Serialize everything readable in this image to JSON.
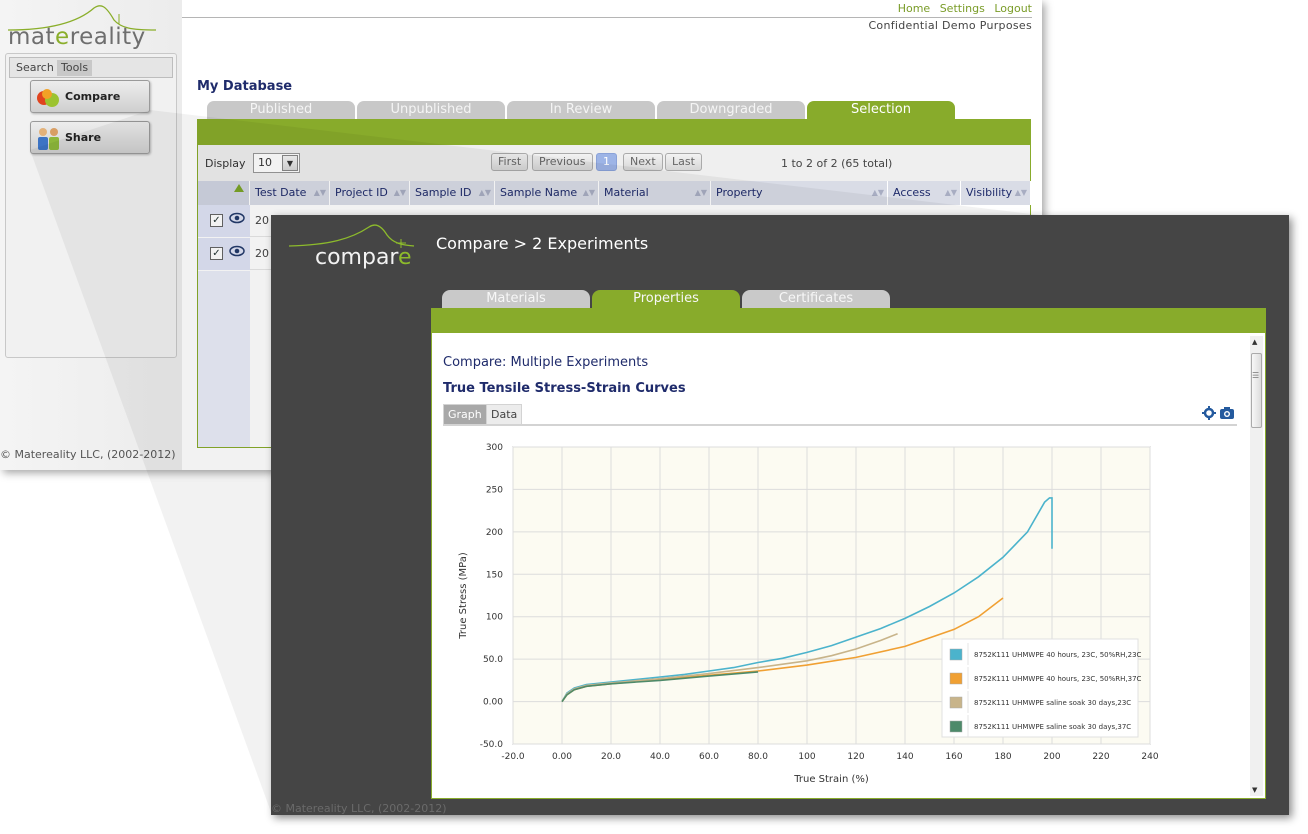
{
  "back": {
    "brand": {
      "prefix": "mat",
      "highlight": "e",
      "suffix": "reality"
    },
    "sidebar_tabs": [
      "Search",
      "Tools"
    ],
    "tools": [
      {
        "label": "Compare",
        "icon": "fruits-icon"
      },
      {
        "label": "Share",
        "icon": "people-icon"
      }
    ],
    "footer": "© Matereality LLC, (2002-2012)",
    "top_links": [
      "Home",
      "Settings",
      "Logout"
    ],
    "confidential": "Confidential Demo Purposes",
    "title": "My Database",
    "status_tabs": [
      "Published",
      "Unpublished",
      "In Review",
      "Downgraded",
      "Selection"
    ],
    "active_status_tab": "Selection",
    "display_label": "Display",
    "display_value": "10",
    "pager": {
      "first": "First",
      "previous": "Previous",
      "current": "1",
      "next": "Next",
      "last": "Last"
    },
    "range_text": "1 to 2 of 2 (65 total)",
    "columns": [
      "Test Date",
      "Project ID",
      "Sample ID",
      "Sample Name",
      "Material",
      "Property",
      "Access",
      "Visibility"
    ],
    "rows": [
      {
        "date_fragment": "20"
      },
      {
        "date_fragment": "20"
      }
    ]
  },
  "front": {
    "logo": {
      "prefix": "compar",
      "highlight": "e"
    },
    "heading": "Compare > 2 Experiments",
    "tabs": [
      "Materials",
      "Properties",
      "Certificates"
    ],
    "active_tab": "Properties",
    "subtitle": "Compare: Multiple Experiments",
    "chart_heading": "True Tensile Stress-Strain Curves",
    "view_tabs": [
      "Graph",
      "Data"
    ],
    "active_view": "Graph",
    "footer": "© Matereality LLC, (2002-2012)"
  },
  "chart_data": {
    "type": "line",
    "title": "",
    "xlabel": "True Strain (%)",
    "ylabel": "True Stress (MPa)",
    "xlim": [
      -20,
      240
    ],
    "ylim": [
      -50,
      300
    ],
    "x_ticks": [
      "-20.0",
      "0.00",
      "20.0",
      "40.0",
      "60.0",
      "80.0",
      "100",
      "120",
      "140",
      "160",
      "180",
      "200",
      "220",
      "240"
    ],
    "y_ticks": [
      "-50.0",
      "0.00",
      "50.0",
      "100",
      "150",
      "200",
      "250",
      "300"
    ],
    "grid": true,
    "legend_position": "bottom-right",
    "series": [
      {
        "name": "8752K111 UHMWPE 40 hours, 23C, 50%RH,23C",
        "color": "#4bb3cc",
        "points": [
          [
            0,
            0
          ],
          [
            2,
            10
          ],
          [
            5,
            16
          ],
          [
            10,
            20
          ],
          [
            20,
            23
          ],
          [
            30,
            26
          ],
          [
            40,
            29
          ],
          [
            50,
            32
          ],
          [
            60,
            36
          ],
          [
            70,
            40
          ],
          [
            80,
            46
          ],
          [
            90,
            51
          ],
          [
            100,
            58
          ],
          [
            110,
            66
          ],
          [
            120,
            76
          ],
          [
            130,
            86
          ],
          [
            140,
            98
          ],
          [
            150,
            112
          ],
          [
            160,
            128
          ],
          [
            170,
            147
          ],
          [
            180,
            170
          ],
          [
            190,
            200
          ],
          [
            197,
            235
          ],
          [
            199,
            240
          ],
          [
            200,
            240
          ],
          [
            200,
            220
          ],
          [
            200,
            180
          ]
        ]
      },
      {
        "name": "8752K111 UHMWPE 40 hours, 23C, 50%RH,37C",
        "color": "#f0a033",
        "points": [
          [
            0,
            0
          ],
          [
            2,
            8
          ],
          [
            5,
            14
          ],
          [
            10,
            18
          ],
          [
            20,
            21
          ],
          [
            40,
            26
          ],
          [
            60,
            31
          ],
          [
            80,
            36
          ],
          [
            100,
            43
          ],
          [
            120,
            52
          ],
          [
            140,
            65
          ],
          [
            160,
            85
          ],
          [
            170,
            100
          ],
          [
            180,
            122
          ]
        ]
      },
      {
        "name": "8752K111 UHMWPE saline soak 30 days,23C",
        "color": "#c8b48a",
        "points": [
          [
            0,
            0
          ],
          [
            2,
            9
          ],
          [
            5,
            15
          ],
          [
            10,
            19
          ],
          [
            20,
            22
          ],
          [
            40,
            27
          ],
          [
            60,
            33
          ],
          [
            80,
            40
          ],
          [
            100,
            48
          ],
          [
            110,
            54
          ],
          [
            120,
            62
          ],
          [
            130,
            72
          ],
          [
            137,
            80
          ]
        ]
      },
      {
        "name": "8752K111 UHMWPE saline soak 30 days,37C",
        "color": "#4d8a6a",
        "points": [
          [
            0,
            0
          ],
          [
            2,
            8
          ],
          [
            5,
            14
          ],
          [
            10,
            18
          ],
          [
            20,
            21
          ],
          [
            40,
            25
          ],
          [
            60,
            30
          ],
          [
            80,
            35
          ]
        ]
      }
    ]
  }
}
